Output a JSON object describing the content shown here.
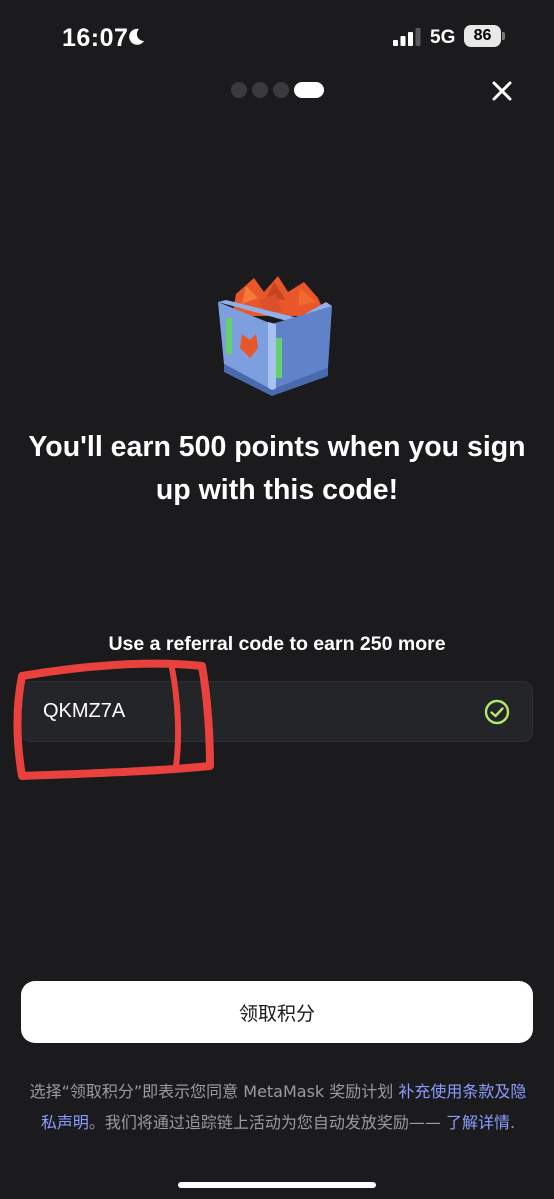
{
  "status_bar": {
    "time": "16:07",
    "network": "5G",
    "battery": "86"
  },
  "pager": {
    "total": 4,
    "active_index": 3
  },
  "headline": "You'll earn 500 points when you sign up with this code!",
  "referral": {
    "label": "Use a referral code to earn 250 more",
    "code": "QKMZ7A",
    "valid": true
  },
  "claim_button_label": "领取积分",
  "disclaimer": {
    "prefix": "选择“领取积分”即表示您同意 MetaMask 奖励计划 ",
    "terms_link": "补充使用条款及隐私声明",
    "middle": "。我们将通过追踪链上活动为您自动发放奖励—— ",
    "learn_more_link": "了解详情",
    "suffix": "."
  },
  "colors": {
    "background": "#1b1b1d",
    "accent_link": "#8b9cff",
    "success": "#b5e86a",
    "annotation": "#e8413e"
  }
}
